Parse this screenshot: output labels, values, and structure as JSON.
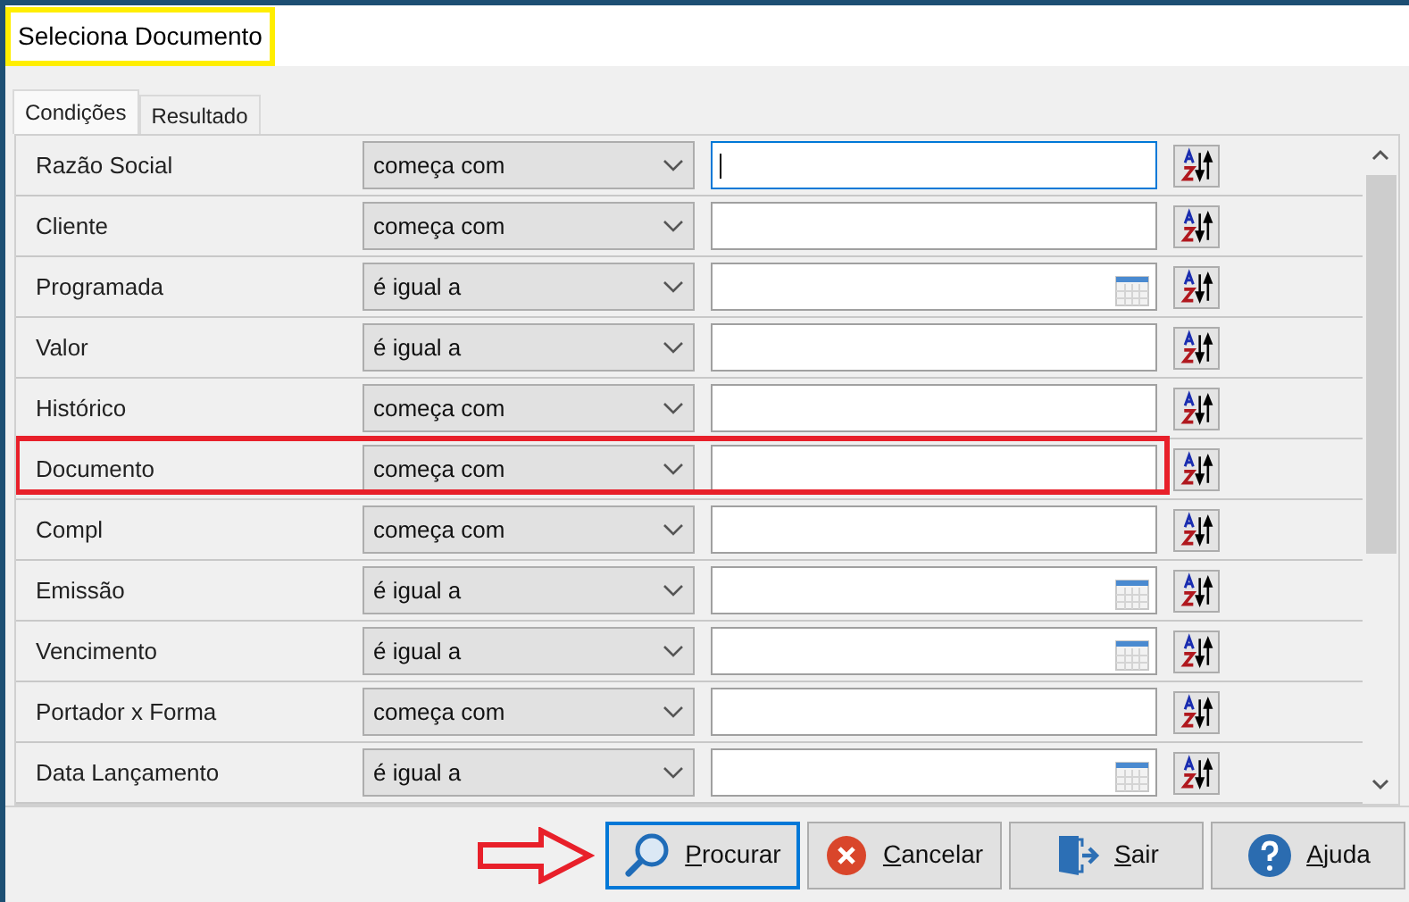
{
  "window": {
    "title": "Seleciona Documento",
    "title_highlighted": true
  },
  "tabs": [
    {
      "label": "Condições",
      "selected": true
    },
    {
      "label": "Resultado",
      "selected": false
    }
  ],
  "conditions": [
    {
      "field": "Razão Social",
      "operator": "começa com",
      "kind": "text",
      "focused": true,
      "highlighted": false
    },
    {
      "field": "Cliente",
      "operator": "começa com",
      "kind": "text",
      "focused": false,
      "highlighted": false
    },
    {
      "field": "Programada",
      "operator": "é igual a",
      "kind": "date",
      "focused": false,
      "highlighted": false
    },
    {
      "field": "Valor",
      "operator": "é igual a",
      "kind": "text",
      "focused": false,
      "highlighted": false
    },
    {
      "field": "Histórico",
      "operator": "começa com",
      "kind": "text",
      "focused": false,
      "highlighted": false
    },
    {
      "field": "Documento",
      "operator": "começa com",
      "kind": "text",
      "focused": false,
      "highlighted": true
    },
    {
      "field": "Compl",
      "operator": "começa com",
      "kind": "text",
      "focused": false,
      "highlighted": false
    },
    {
      "field": "Emissão",
      "operator": "é igual a",
      "kind": "date",
      "focused": false,
      "highlighted": false
    },
    {
      "field": "Vencimento",
      "operator": "é igual a",
      "kind": "date",
      "focused": false,
      "highlighted": false
    },
    {
      "field": "Portador x Forma",
      "operator": "começa com",
      "kind": "text",
      "focused": false,
      "highlighted": false
    },
    {
      "field": "Data Lançamento",
      "operator": "é igual a",
      "kind": "date",
      "focused": false,
      "highlighted": false
    }
  ],
  "buttons": [
    {
      "label": "Procurar",
      "kind": "search",
      "focused": true,
      "pointed_at": true
    },
    {
      "label": "Cancelar",
      "kind": "cancel",
      "focused": false,
      "pointed_at": false
    },
    {
      "label": "Sair",
      "kind": "exit",
      "focused": false,
      "pointed_at": false
    },
    {
      "label": "Ajuda",
      "kind": "help",
      "focused": false,
      "pointed_at": false
    }
  ]
}
